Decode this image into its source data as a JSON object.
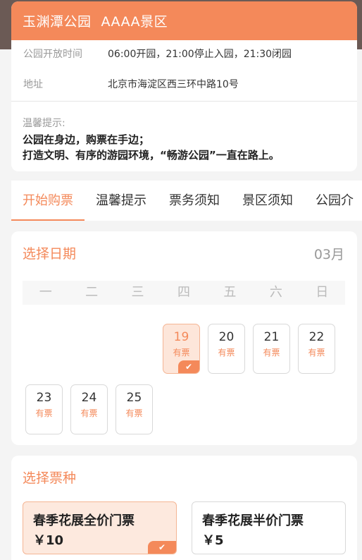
{
  "header": {
    "park_name": "玉渊潭公园",
    "rating": "AAAA景区",
    "hours_label": "公园开放时间",
    "hours_value": "06:00开园，21:00停止入园，21:30闭园",
    "address_label": "地址",
    "address_value": "北京市海淀区西三环中路10号"
  },
  "tips": {
    "title": "温馨提示:",
    "line1": "公园在身边，购票在手边；",
    "line2": "打造文明、有序的游园环境，“畅游公园”一直在路上。"
  },
  "tabs": [
    {
      "label": "开始购票",
      "active": true
    },
    {
      "label": "温馨提示",
      "active": false
    },
    {
      "label": "票务须知",
      "active": false
    },
    {
      "label": "景区须知",
      "active": false
    },
    {
      "label": "公园介",
      "active": false
    }
  ],
  "date_section": {
    "title": "选择日期",
    "month": "03月",
    "weekdays": [
      "一",
      "二",
      "三",
      "四",
      "五",
      "六",
      "日"
    ],
    "days": [
      {
        "day": "19",
        "status": "有票",
        "selected": true
      },
      {
        "day": "20",
        "status": "有票",
        "selected": false
      },
      {
        "day": "21",
        "status": "有票",
        "selected": false
      },
      {
        "day": "22",
        "status": "有票",
        "selected": false
      },
      {
        "day": "23",
        "status": "有票",
        "selected": false
      },
      {
        "day": "24",
        "status": "有票",
        "selected": false
      },
      {
        "day": "25",
        "status": "有票",
        "selected": false
      }
    ]
  },
  "ticket_section": {
    "title": "选择票种",
    "tickets": [
      {
        "name": "春季花展全价门票",
        "price": "￥10",
        "selected": true
      },
      {
        "name": "春季花展半价门票",
        "price": "￥5",
        "selected": false
      }
    ]
  },
  "colors": {
    "accent": "#f4895a",
    "selected_bg": "#fde6da"
  },
  "icons": {
    "check": "checkmark-icon"
  }
}
